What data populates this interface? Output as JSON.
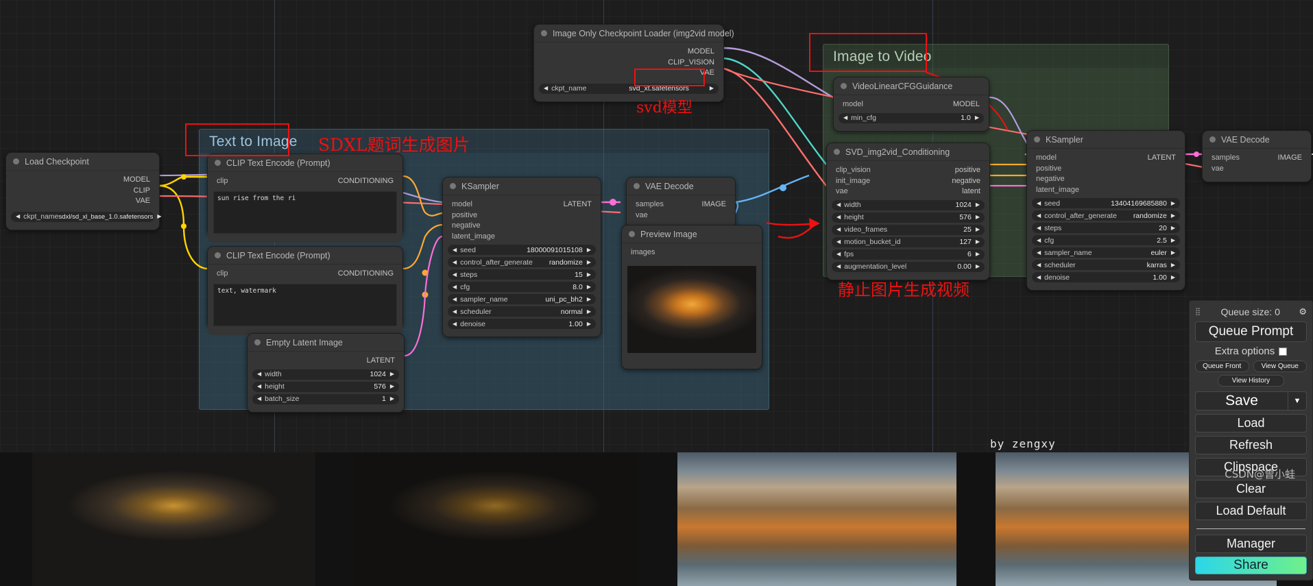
{
  "app": {
    "watermark": "CSDN@曾小蛙",
    "author_note": "by zengxy"
  },
  "groups": [
    {
      "title": "Text to Image",
      "color": "#3f6f8f"
    },
    {
      "title": "Image to Video",
      "color": "#4a6a4a"
    }
  ],
  "annotations": [
    {
      "text": "SDXL题词生成图片"
    },
    {
      "text": "svd模型"
    },
    {
      "text": "静止图片生成视频"
    }
  ],
  "nodes": {
    "load_checkpoint": {
      "title": "Load Checkpoint",
      "outputs": [
        "MODEL",
        "CLIP",
        "VAE"
      ],
      "widgets": [
        {
          "name": "ckpt_name",
          "value": "sdxl/sd_xl_base_1.0.safetensors"
        }
      ]
    },
    "img_only_ckpt_loader": {
      "title": "Image Only Checkpoint Loader (img2vid model)",
      "outputs": [
        "MODEL",
        "CLIP_VISION",
        "VAE"
      ],
      "widgets": [
        {
          "name": "ckpt_name",
          "value": "svd_xt.safetensors"
        }
      ]
    },
    "clip_text_encode_positive": {
      "title": "CLIP Text Encode (Prompt)",
      "input": "clip",
      "output": "CONDITIONING",
      "text": "sun rise from the ri"
    },
    "clip_text_encode_negative": {
      "title": "CLIP Text Encode (Prompt)",
      "input": "clip",
      "output": "CONDITIONING",
      "text": "text, watermark"
    },
    "empty_latent_image": {
      "title": "Empty Latent Image",
      "output": "LATENT",
      "widgets": [
        {
          "name": "width",
          "value": "1024"
        },
        {
          "name": "height",
          "value": "576"
        },
        {
          "name": "batch_size",
          "value": "1"
        }
      ]
    },
    "ksampler_1": {
      "title": "KSampler",
      "inputs": [
        "model",
        "positive",
        "negative",
        "latent_image"
      ],
      "outputs": [
        "LATENT"
      ],
      "widgets": [
        {
          "name": "seed",
          "value": "18000091015108"
        },
        {
          "name": "control_after_generate",
          "value": "randomize"
        },
        {
          "name": "steps",
          "value": "15"
        },
        {
          "name": "cfg",
          "value": "8.0"
        },
        {
          "name": "sampler_name",
          "value": "uni_pc_bh2"
        },
        {
          "name": "scheduler",
          "value": "normal"
        },
        {
          "name": "denoise",
          "value": "1.00"
        }
      ]
    },
    "vae_decode_1": {
      "title": "VAE Decode",
      "inputs": [
        "samples",
        "vae"
      ],
      "outputs": [
        "IMAGE"
      ]
    },
    "preview_image": {
      "title": "Preview Image",
      "inputs": [
        "images"
      ]
    },
    "video_linear_cfg": {
      "title": "VideoLinearCFGGuidance",
      "inputs": [
        "model"
      ],
      "outputs": [
        "MODEL"
      ],
      "widgets": [
        {
          "name": "min_cfg",
          "value": "1.0"
        }
      ]
    },
    "svd_img2vid_conditioning": {
      "title": "SVD_img2vid_Conditioning",
      "inputs": [
        "clip_vision",
        "init_image",
        "vae"
      ],
      "outputs": [
        "positive",
        "negative",
        "latent"
      ],
      "widgets": [
        {
          "name": "width",
          "value": "1024"
        },
        {
          "name": "height",
          "value": "576"
        },
        {
          "name": "video_frames",
          "value": "25"
        },
        {
          "name": "motion_bucket_id",
          "value": "127"
        },
        {
          "name": "fps",
          "value": "6"
        },
        {
          "name": "augmentation_level",
          "value": "0.00"
        }
      ]
    },
    "ksampler_2": {
      "title": "KSampler",
      "inputs": [
        "model",
        "positive",
        "negative",
        "latent_image"
      ],
      "outputs": [
        "LATENT"
      ],
      "widgets": [
        {
          "name": "seed",
          "value": "13404169685880"
        },
        {
          "name": "control_after_generate",
          "value": "randomize"
        },
        {
          "name": "steps",
          "value": "20"
        },
        {
          "name": "cfg",
          "value": "2.5"
        },
        {
          "name": "sampler_name",
          "value": "euler"
        },
        {
          "name": "scheduler",
          "value": "karras"
        },
        {
          "name": "denoise",
          "value": "1.00"
        }
      ]
    },
    "vae_decode_2": {
      "title": "VAE Decode",
      "inputs": [
        "samples",
        "vae"
      ],
      "outputs": [
        "IMAGE"
      ]
    }
  },
  "panel": {
    "queue_size_label": "Queue size: 0",
    "gear_icon": "gear-icon",
    "queue_prompt": "Queue Prompt",
    "extra_options": "Extra options",
    "queue_front": "Queue Front",
    "view_queue": "View Queue",
    "view_history": "View History",
    "save": "Save",
    "save_caret": "▼",
    "load": "Load",
    "refresh": "Refresh",
    "clipspace": "Clipspace",
    "clear": "Clear",
    "load_default": "Load Default",
    "manager": "Manager",
    "share": "Share"
  },
  "colors": {
    "model_slot": "#b39ddb",
    "clip_slot": "#ffd500",
    "vae_slot": "#ff6e6e",
    "conditioning_slot": "#ffa931",
    "latent_slot": "#ff6ed7",
    "image_slot": "#64b5f6",
    "clipvision_slot": "#4fd6c8",
    "group_blue": "#3f6f8f",
    "group_green": "#4a6a4a",
    "annotation_red": "#ee1111"
  }
}
